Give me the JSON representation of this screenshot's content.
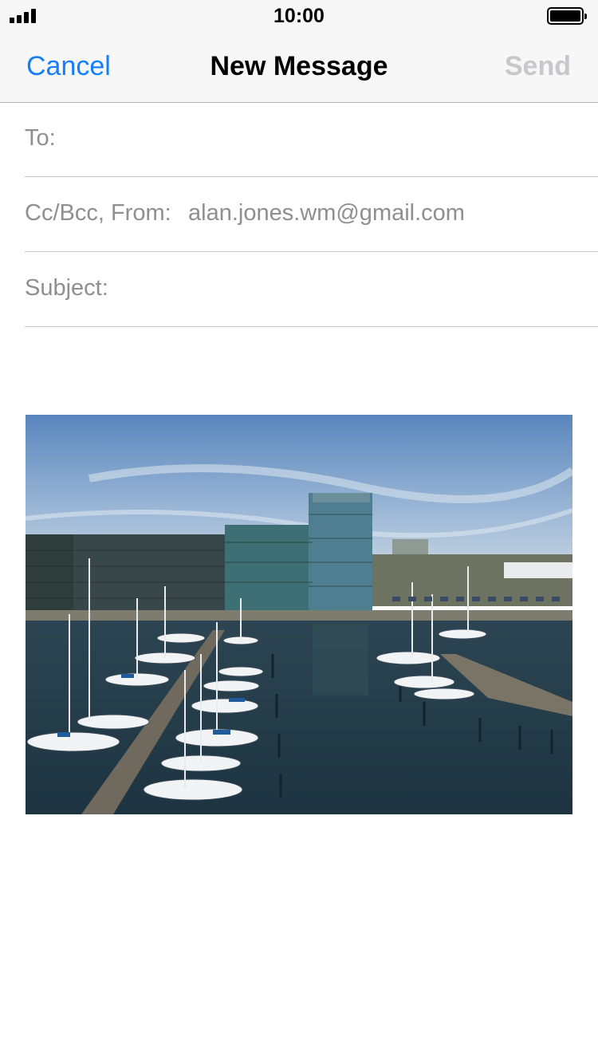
{
  "status_bar": {
    "time": "10:00"
  },
  "nav": {
    "cancel_label": "Cancel",
    "title": "New Message",
    "send_label": "Send"
  },
  "fields": {
    "to_label": "To:",
    "ccbcc_label": "Cc/Bcc, From:",
    "from_value": "alan.jones.wm@gmail.com",
    "subject_label": "Subject:"
  },
  "colors": {
    "accent": "#147efb",
    "disabled": "#c7c7cc",
    "secondary_text": "#8e8e93"
  },
  "attachment": {
    "icon": "photo-attachment"
  }
}
